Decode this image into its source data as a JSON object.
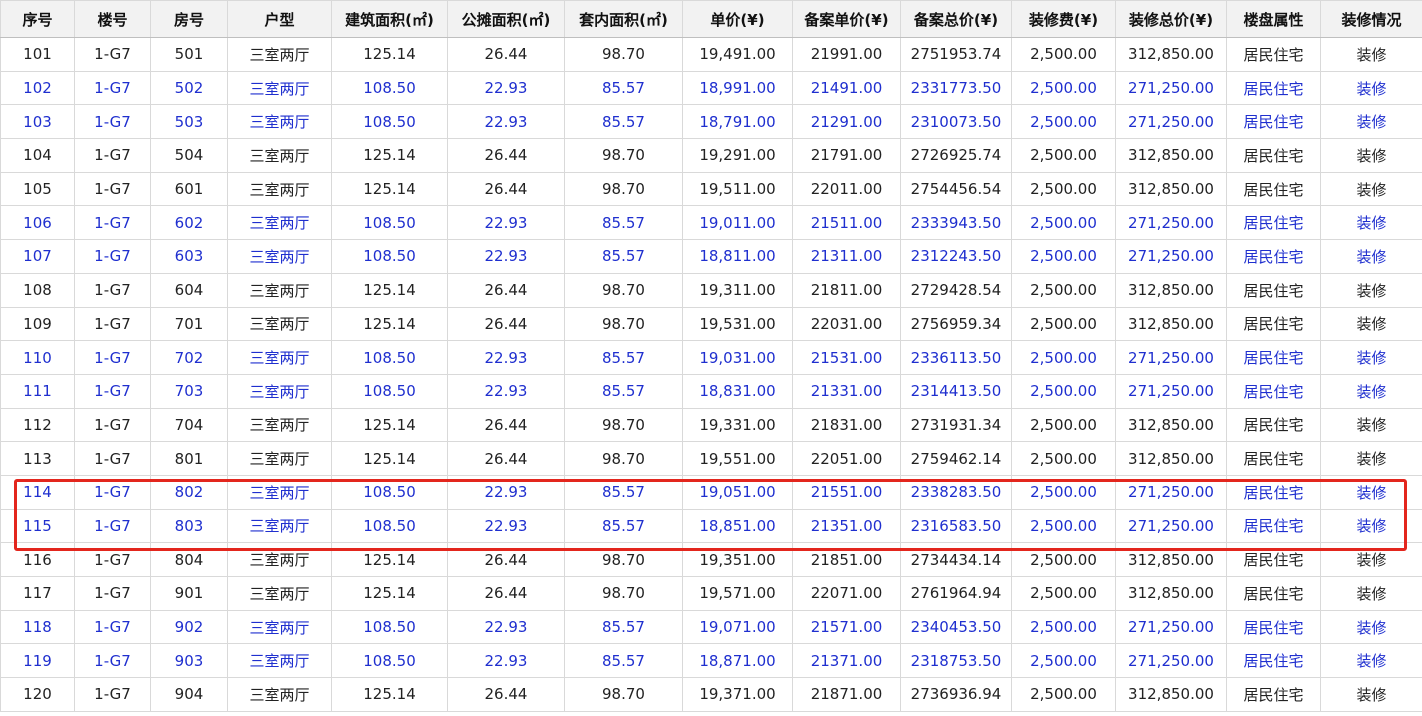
{
  "table": {
    "columns": [
      "序号",
      "楼号",
      "房号",
      "户型",
      "建筑面积(㎡)",
      "公摊面积(㎡)",
      "套内面积(㎡)",
      "单价(¥)",
      "备案单价(¥)",
      "备案总价(¥)",
      "装修费(¥)",
      "装修总价(¥)",
      "楼盘属性",
      "装修情况"
    ],
    "rows": [
      {
        "style": "black",
        "cells": [
          "101",
          "1-G7",
          "501",
          "三室两厅",
          "125.14",
          "26.44",
          "98.70",
          "19,491.00",
          "21991.00",
          "2751953.74",
          "2,500.00",
          "312,850.00",
          "居民住宅",
          "装修"
        ]
      },
      {
        "style": "blue",
        "cells": [
          "102",
          "1-G7",
          "502",
          "三室两厅",
          "108.50",
          "22.93",
          "85.57",
          "18,991.00",
          "21491.00",
          "2331773.50",
          "2,500.00",
          "271,250.00",
          "居民住宅",
          "装修"
        ]
      },
      {
        "style": "blue",
        "cells": [
          "103",
          "1-G7",
          "503",
          "三室两厅",
          "108.50",
          "22.93",
          "85.57",
          "18,791.00",
          "21291.00",
          "2310073.50",
          "2,500.00",
          "271,250.00",
          "居民住宅",
          "装修"
        ]
      },
      {
        "style": "black",
        "cells": [
          "104",
          "1-G7",
          "504",
          "三室两厅",
          "125.14",
          "26.44",
          "98.70",
          "19,291.00",
          "21791.00",
          "2726925.74",
          "2,500.00",
          "312,850.00",
          "居民住宅",
          "装修"
        ]
      },
      {
        "style": "black",
        "cells": [
          "105",
          "1-G7",
          "601",
          "三室两厅",
          "125.14",
          "26.44",
          "98.70",
          "19,511.00",
          "22011.00",
          "2754456.54",
          "2,500.00",
          "312,850.00",
          "居民住宅",
          "装修"
        ]
      },
      {
        "style": "blue",
        "cells": [
          "106",
          "1-G7",
          "602",
          "三室两厅",
          "108.50",
          "22.93",
          "85.57",
          "19,011.00",
          "21511.00",
          "2333943.50",
          "2,500.00",
          "271,250.00",
          "居民住宅",
          "装修"
        ]
      },
      {
        "style": "blue",
        "cells": [
          "107",
          "1-G7",
          "603",
          "三室两厅",
          "108.50",
          "22.93",
          "85.57",
          "18,811.00",
          "21311.00",
          "2312243.50",
          "2,500.00",
          "271,250.00",
          "居民住宅",
          "装修"
        ]
      },
      {
        "style": "black",
        "cells": [
          "108",
          "1-G7",
          "604",
          "三室两厅",
          "125.14",
          "26.44",
          "98.70",
          "19,311.00",
          "21811.00",
          "2729428.54",
          "2,500.00",
          "312,850.00",
          "居民住宅",
          "装修"
        ]
      },
      {
        "style": "black",
        "cells": [
          "109",
          "1-G7",
          "701",
          "三室两厅",
          "125.14",
          "26.44",
          "98.70",
          "19,531.00",
          "22031.00",
          "2756959.34",
          "2,500.00",
          "312,850.00",
          "居民住宅",
          "装修"
        ]
      },
      {
        "style": "blue",
        "cells": [
          "110",
          "1-G7",
          "702",
          "三室两厅",
          "108.50",
          "22.93",
          "85.57",
          "19,031.00",
          "21531.00",
          "2336113.50",
          "2,500.00",
          "271,250.00",
          "居民住宅",
          "装修"
        ]
      },
      {
        "style": "blue",
        "cells": [
          "111",
          "1-G7",
          "703",
          "三室两厅",
          "108.50",
          "22.93",
          "85.57",
          "18,831.00",
          "21331.00",
          "2314413.50",
          "2,500.00",
          "271,250.00",
          "居民住宅",
          "装修"
        ]
      },
      {
        "style": "black",
        "cells": [
          "112",
          "1-G7",
          "704",
          "三室两厅",
          "125.14",
          "26.44",
          "98.70",
          "19,331.00",
          "21831.00",
          "2731931.34",
          "2,500.00",
          "312,850.00",
          "居民住宅",
          "装修"
        ]
      },
      {
        "style": "black",
        "cells": [
          "113",
          "1-G7",
          "801",
          "三室两厅",
          "125.14",
          "26.44",
          "98.70",
          "19,551.00",
          "22051.00",
          "2759462.14",
          "2,500.00",
          "312,850.00",
          "居民住宅",
          "装修"
        ]
      },
      {
        "style": "blue",
        "cells": [
          "114",
          "1-G7",
          "802",
          "三室两厅",
          "108.50",
          "22.93",
          "85.57",
          "19,051.00",
          "21551.00",
          "2338283.50",
          "2,500.00",
          "271,250.00",
          "居民住宅",
          "装修"
        ]
      },
      {
        "style": "blue",
        "cells": [
          "115",
          "1-G7",
          "803",
          "三室两厅",
          "108.50",
          "22.93",
          "85.57",
          "18,851.00",
          "21351.00",
          "2316583.50",
          "2,500.00",
          "271,250.00",
          "居民住宅",
          "装修"
        ]
      },
      {
        "style": "black",
        "cells": [
          "116",
          "1-G7",
          "804",
          "三室两厅",
          "125.14",
          "26.44",
          "98.70",
          "19,351.00",
          "21851.00",
          "2734434.14",
          "2,500.00",
          "312,850.00",
          "居民住宅",
          "装修"
        ]
      },
      {
        "style": "black",
        "cells": [
          "117",
          "1-G7",
          "901",
          "三室两厅",
          "125.14",
          "26.44",
          "98.70",
          "19,571.00",
          "22071.00",
          "2761964.94",
          "2,500.00",
          "312,850.00",
          "居民住宅",
          "装修"
        ]
      },
      {
        "style": "blue",
        "cells": [
          "118",
          "1-G7",
          "902",
          "三室两厅",
          "108.50",
          "22.93",
          "85.57",
          "19,071.00",
          "21571.00",
          "2340453.50",
          "2,500.00",
          "271,250.00",
          "居民住宅",
          "装修"
        ]
      },
      {
        "style": "blue",
        "cells": [
          "119",
          "1-G7",
          "903",
          "三室两厅",
          "108.50",
          "22.93",
          "85.57",
          "18,871.00",
          "21371.00",
          "2318753.50",
          "2,500.00",
          "271,250.00",
          "居民住宅",
          "装修"
        ]
      },
      {
        "style": "black",
        "cells": [
          "120",
          "1-G7",
          "904",
          "三室两厅",
          "125.14",
          "26.44",
          "98.70",
          "19,371.00",
          "21871.00",
          "2736936.94",
          "2,500.00",
          "312,850.00",
          "居民住宅",
          "装修"
        ]
      }
    ],
    "highlighted_rows": [
      "114",
      "115"
    ]
  },
  "colors": {
    "text_default": "#222222",
    "text_blue": "#1f2fcf",
    "header_background": "#f2f2f2",
    "grid_line": "#d9d9d9",
    "highlight_border": "#e3261d"
  }
}
